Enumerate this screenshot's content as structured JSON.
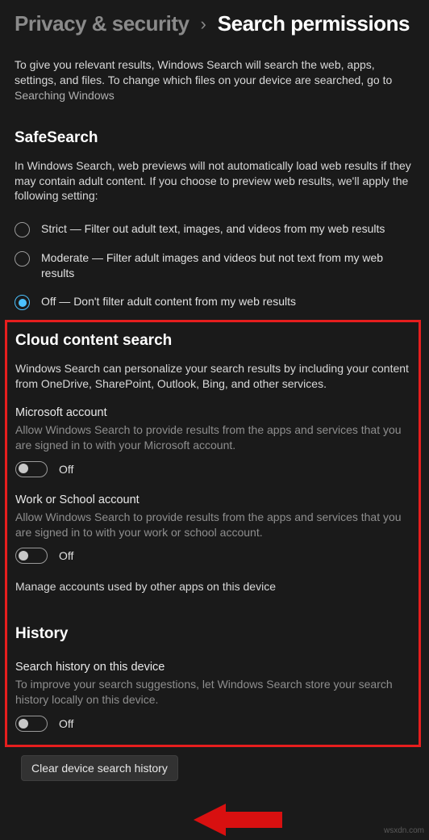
{
  "breadcrumb": {
    "back": "Privacy & security",
    "current": "Search permissions"
  },
  "intro": {
    "text": "To give you relevant results, Windows Search will search the web, apps, settings, and files. To change which files on your device are searched, go to ",
    "link": "Searching Windows"
  },
  "safesearch": {
    "title": "SafeSearch",
    "desc": "In Windows Search, web previews will not automatically load web results if they may contain adult content. If you choose to preview web results, we'll apply the following setting:",
    "options": {
      "strict": "Strict — Filter out adult text, images, and videos from my web results",
      "moderate": "Moderate — Filter adult images and videos but not text from my web results",
      "off": "Off — Don't filter adult content from my web results"
    },
    "selected": "off"
  },
  "cloud": {
    "title": "Cloud content search",
    "desc": "Windows Search can personalize your search results by including your content from OneDrive, SharePoint, Outlook, Bing, and other services.",
    "ms": {
      "head": "Microsoft account",
      "desc": "Allow Windows Search to provide results from the apps and services that you are signed in to with your Microsoft account.",
      "state": "Off"
    },
    "work": {
      "head": "Work or School account",
      "desc": "Allow Windows Search to provide results from the apps and services that you are signed in to with your work or school account.",
      "state": "Off"
    },
    "manage": "Manage accounts used by other apps on this device"
  },
  "history": {
    "title": "History",
    "sub": "Search history on this device",
    "desc": "To improve your search suggestions, let Windows Search store your search history locally on this device.",
    "state": "Off"
  },
  "clear_button": "Clear device search history",
  "watermark": "wsxdn.com"
}
